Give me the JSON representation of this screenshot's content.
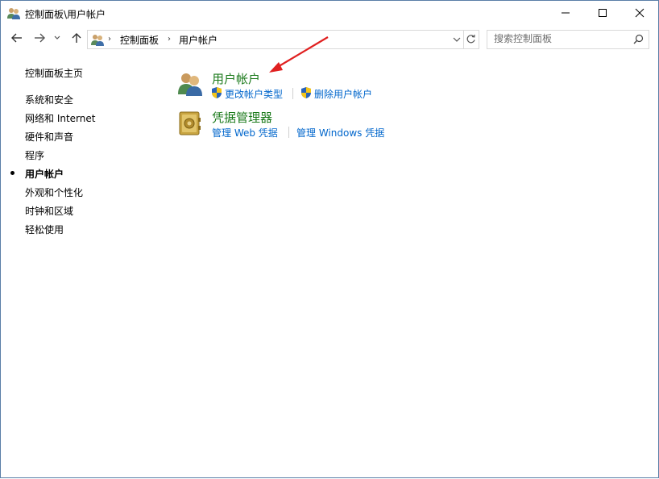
{
  "window": {
    "title": "控制面板\\用户帐户",
    "controls": {
      "minimize": "minimize-icon",
      "maximize": "maximize-icon",
      "close": "close-icon"
    }
  },
  "addressbar": {
    "crumbs": [
      "控制面板",
      "用户帐户"
    ],
    "search_placeholder": "搜索控制面板"
  },
  "sidebar": {
    "home": "控制面板主页",
    "items": [
      {
        "label": "系统和安全",
        "current": false
      },
      {
        "label": "网络和 Internet",
        "current": false
      },
      {
        "label": "硬件和声音",
        "current": false
      },
      {
        "label": "程序",
        "current": false
      },
      {
        "label": "用户帐户",
        "current": true
      },
      {
        "label": "外观和个性化",
        "current": false
      },
      {
        "label": "时钟和区域",
        "current": false
      },
      {
        "label": "轻松使用",
        "current": false
      }
    ]
  },
  "categories": [
    {
      "title": "用户帐户",
      "icon": "user-accounts-icon",
      "links": [
        {
          "label": "更改帐户类型",
          "shield": true
        },
        {
          "label": "删除用户帐户",
          "shield": true
        }
      ]
    },
    {
      "title": "凭据管理器",
      "icon": "credential-manager-icon",
      "links": [
        {
          "label": "管理 Web 凭据",
          "shield": false
        },
        {
          "label": "管理 Windows 凭据",
          "shield": false
        }
      ]
    }
  ],
  "colors": {
    "category_title": "#1b7a1b",
    "link": "#0066cc",
    "annotation_arrow": "#e02020"
  }
}
